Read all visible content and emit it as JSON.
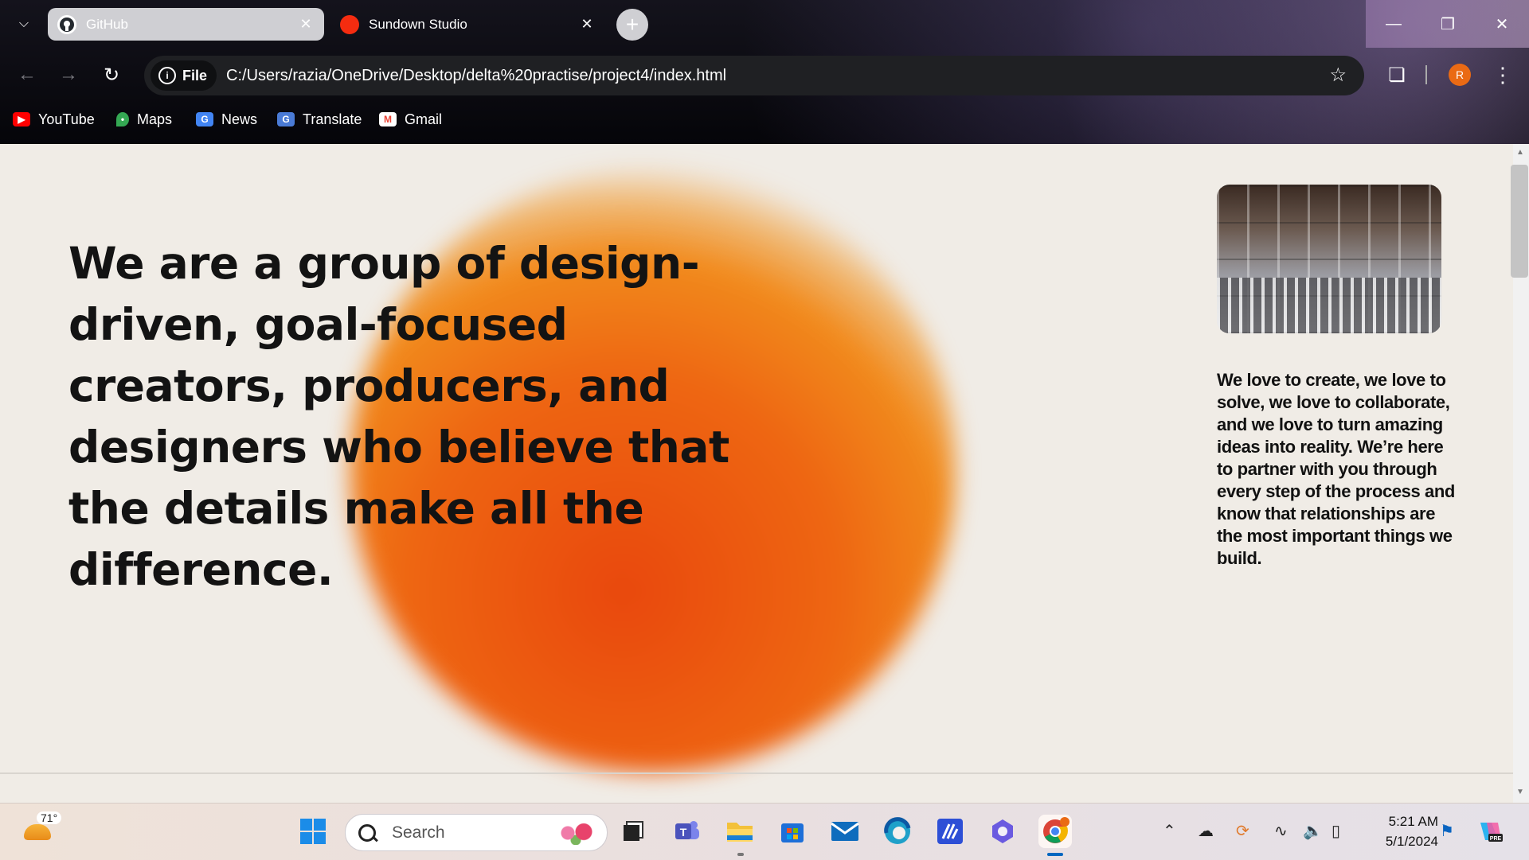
{
  "browser": {
    "tabs": [
      {
        "title": "GitHub",
        "active": true,
        "favicon": "github-icon"
      },
      {
        "title": "Sundown Studio",
        "active": false,
        "favicon": "red-dot-icon"
      }
    ],
    "site_chip": "File",
    "url": "C:/Users/razia/OneDrive/Desktop/delta%20practise/project4/index.html",
    "profile_initial": "R",
    "bookmarks": [
      {
        "label": "YouTube",
        "icon": "youtube-icon"
      },
      {
        "label": "Maps",
        "icon": "maps-icon"
      },
      {
        "label": "News",
        "icon": "news-icon"
      },
      {
        "label": "Translate",
        "icon": "translate-icon"
      },
      {
        "label": "Gmail",
        "icon": "gmail-icon"
      }
    ]
  },
  "page": {
    "headline": "We are a group of design-driven, goal-focused creators, producers, and designers who believe that the details make all the difference.",
    "side_text": "We love to create, we love to solve, we love to collaborate, and we love to turn amazing ideas into reality. We’re here to partner with you through every step of the process and know that relationships are the most important things we build.",
    "accent_color": "#ee5a10",
    "background_color": "#f0ece6"
  },
  "taskbar": {
    "weather_temp": "71°",
    "search_placeholder": "Search",
    "time": "5:21 AM",
    "date": "5/1/2024",
    "apps": [
      "windows-start-icon",
      "task-view-icon",
      "teams-icon",
      "file-explorer-icon",
      "microsoft-store-icon",
      "mail-icon",
      "edge-icon",
      "vs-code-like-icon",
      "copilot-app-icon",
      "chrome-icon"
    ],
    "tray_icons": [
      "chevron-up-icon",
      "onedrive-icon",
      "sync-icon",
      "wifi-icon",
      "volume-icon",
      "battery-icon",
      "notification-bell-icon",
      "copilot-icon"
    ]
  }
}
